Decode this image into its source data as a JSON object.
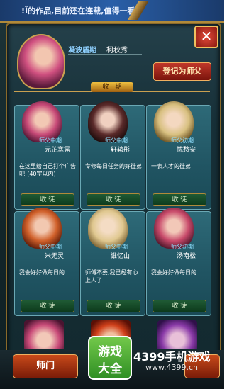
{
  "banner": {
    "text": "!Ǐ的作品,目前还在连载,值得一看!"
  },
  "close_label": "✕",
  "header": {
    "status": "凝波盾期",
    "name": "柯秋秀",
    "register_label": "登记为师父"
  },
  "tab_label": "收一期",
  "cards": [
    {
      "role": "师父中期",
      "name": "元芷寒露",
      "message": "在这里给自己打个广告吧!(40字以内)",
      "button": "收 徒",
      "colors": [
        "#f2c8b4",
        "#c84a78",
        "#4a1430"
      ]
    },
    {
      "role": "师父中期",
      "name": "轩辕彤",
      "message": "专修每日任务的好徒弟",
      "button": "收 徒",
      "colors": [
        "#f0d0c0",
        "#5a2a2a",
        "#1a0a0a"
      ]
    },
    {
      "role": "师父初期",
      "name": "忧愁安",
      "message": "一表人才的徒弟",
      "button": "收 徒",
      "colors": [
        "#f4d8c0",
        "#d8c080",
        "#6a5020"
      ]
    },
    {
      "role": "师父中期",
      "name": "米无灵",
      "message": "我会好好做每日的",
      "button": "收 徒",
      "colors": [
        "#f2c8b0",
        "#d0602a",
        "#5a1a08"
      ]
    },
    {
      "role": "师父中期",
      "name": "谁忆山",
      "message": "师傅不要,我已经有心上人了",
      "button": "收 徒",
      "colors": [
        "#f4dcc4",
        "#e0c890",
        "#7a6030"
      ]
    },
    {
      "role": "师父初期",
      "name": "汤南松",
      "message": "我会好好做每日的",
      "button": "收 徒",
      "colors": [
        "#f2c8b8",
        "#c84a6a",
        "#4a1428"
      ]
    }
  ],
  "bottom": {
    "master_label": "师门"
  },
  "watermark": {
    "logo_line1": "游戏",
    "logo_line2": "大全",
    "brand": "4399手机游戏",
    "url": "www.4399.cn"
  }
}
